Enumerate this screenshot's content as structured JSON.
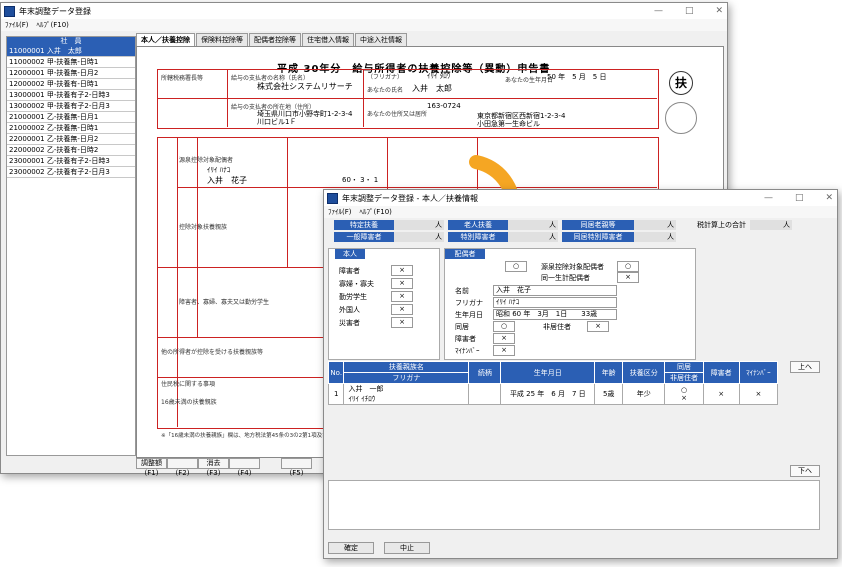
{
  "back": {
    "title": "年末調整データ登録",
    "menu": [
      "ﾌｧｲﾙ(F)",
      "ﾍﾙﾌﾟ(F10)"
    ],
    "emp_header": "社　員",
    "employees": [
      "11000001 入井　太郎",
      "11000002 甲-扶養無-日時1",
      "12000001 甲-扶養無-日月2",
      "12000002 甲-扶養有-日時1",
      "13000001 甲-扶養有子2-日時3",
      "13000002 甲-扶養有子2-日月3",
      "21000001 乙-扶養無-日月1",
      "21000002 乙-扶養無-日時1",
      "22000001 乙-扶養無-日月2",
      "22000002 乙-扶養有-日時2",
      "23000001 乙-扶養有子2-日時3",
      "23000002 乙-扶養有子2-日月3"
    ],
    "tabs": [
      "本人／扶養控除",
      "保険料控除等",
      "配偶者控除等",
      "住宅借入情報",
      "中途入社情報"
    ],
    "form": {
      "title": "平成 30年分　給与所得者の扶養控除等（異動）申告書",
      "payer_label": "所轄税務署長等",
      "payer_name_label": "給与の支払者の名称（氏名）",
      "payer_name": "株式会社システムリサーチ",
      "payer_addr_label": "給与の支払者の所在地（住所）",
      "payer_addr": "埼玉県川口市小野寺町1-2-3-4",
      "payer_addr2": "川口ビル1Ｆ",
      "furigana_label": "（フリガナ）",
      "furigana_val": "ｲﾘｲ ﾀﾛｳ",
      "name_label": "あなたの氏名",
      "name_val": "入井　太郎",
      "birth_label": "あなたの生年月日",
      "birth_val": "50 年　5 月　5 日",
      "address_label": "あなたの住所又は居所",
      "postal": "163-0724",
      "address": "東京都新宿区西新宿1-2-3-4",
      "address2": "小田急第一生命ビル",
      "seal": "扶",
      "dep_furigana": "ｲﾘｲ ﾊﾅｺ",
      "dep_name": "入井　花子",
      "dep_birth": "60・ 3・ 1",
      "section_a": "源泉控除対象配偶者",
      "section_b": "控除対象扶養親族",
      "section_c": "障害者、寡婦、寡夫又は勤労学生",
      "section_d": "他の所得者が控除を受ける扶養親族等",
      "section_e": "住民税に関する事項",
      "section_f": "16歳未満の扶養親族",
      "note": "※「16歳未満の扶養親族」欄は、地方税法第45条の3の2第1項及び第317条の3の2第1項に基づき、給与所得者の扶養親族申告書の記載欄を兼ねています。"
    },
    "fkeys": [
      {
        "label": "調整額",
        "key": "(F1)"
      },
      {
        "label": "",
        "key": "(F2)"
      },
      {
        "label": "消去",
        "key": "(F3)"
      },
      {
        "label": "",
        "key": "(F4)"
      },
      {
        "label": "",
        "key": "(F5)"
      },
      {
        "label": "",
        "key": "(F6)"
      }
    ]
  },
  "front": {
    "title": "年末調整データ登録 - 本人／扶養情報",
    "menu": [
      "ﾌｧｲﾙ(F)",
      "ﾍﾙﾌﾟ(F10)"
    ],
    "summary": [
      {
        "label": "特定扶養",
        "value": "人"
      },
      {
        "label": "老人扶養",
        "value": "人"
      },
      {
        "label": "同居老親等",
        "value": "人"
      },
      {
        "label": "一般障害者",
        "value": "人"
      },
      {
        "label": "特別障害者",
        "value": "人"
      },
      {
        "label": "同居特別障害者",
        "value": "人"
      }
    ],
    "tax_total_label": "税計算上の合計",
    "tax_total_value": "人",
    "self_header": "本人",
    "self_items": [
      {
        "label": "障害者",
        "value": "×"
      },
      {
        "label": "寡婦・寡夫",
        "value": "×"
      },
      {
        "label": "勤労学生",
        "value": "×"
      },
      {
        "label": "外国人",
        "value": "×"
      },
      {
        "label": "災害者",
        "value": "×"
      }
    ],
    "spouse_header": "配偶者",
    "spouse": {
      "umu_value": "○",
      "gensen_label": "源泉控除対象配偶者",
      "gensen_value": "○",
      "dosei_label": "同一生計配偶者",
      "dosei_value": "×",
      "name_label": "名前",
      "name_value": "入井　花子",
      "kana_label": "フリガナ",
      "kana_value": "ｲﾘｲ ﾊﾅｺ",
      "birth_label": "生年月日",
      "birth_value": "昭和 60 年　3月　1日　　33歳",
      "dokyo_label": "同居",
      "dokyo_value": "○",
      "hikyojusha_label": "非居住者",
      "hikyojusha_value": "×",
      "shogai_label": "障害者",
      "shogai_value": "×",
      "mynumber_label": "ﾏｲﾅﾝﾊﾞｰ",
      "mynumber_value": "×"
    },
    "grid": {
      "headers": [
        "No.",
        "扶養親族名",
        "続柄",
        "生年月日",
        "年齢",
        "扶養区分",
        "同居",
        "障害者",
        "ﾏｲﾅﾝﾊﾞｰ"
      ],
      "header_furigana": "フリガナ",
      "header_hikyo": "非居住者",
      "rows": [
        {
          "no": "1",
          "name": "入井　一郎",
          "kana": "ｲﾘｲ ｲﾁﾛｳ",
          "rel": "",
          "birth": "平成 25 年　6 月　7 日",
          "age": "5歳",
          "kubun": "年少",
          "dokyo": "○",
          "hikyo": "×",
          "shogai": "×",
          "mynumber": "×"
        }
      ]
    },
    "up_button": "上へ",
    "down_button": "下へ",
    "ok_button": "確定",
    "cancel_button": "中止"
  }
}
